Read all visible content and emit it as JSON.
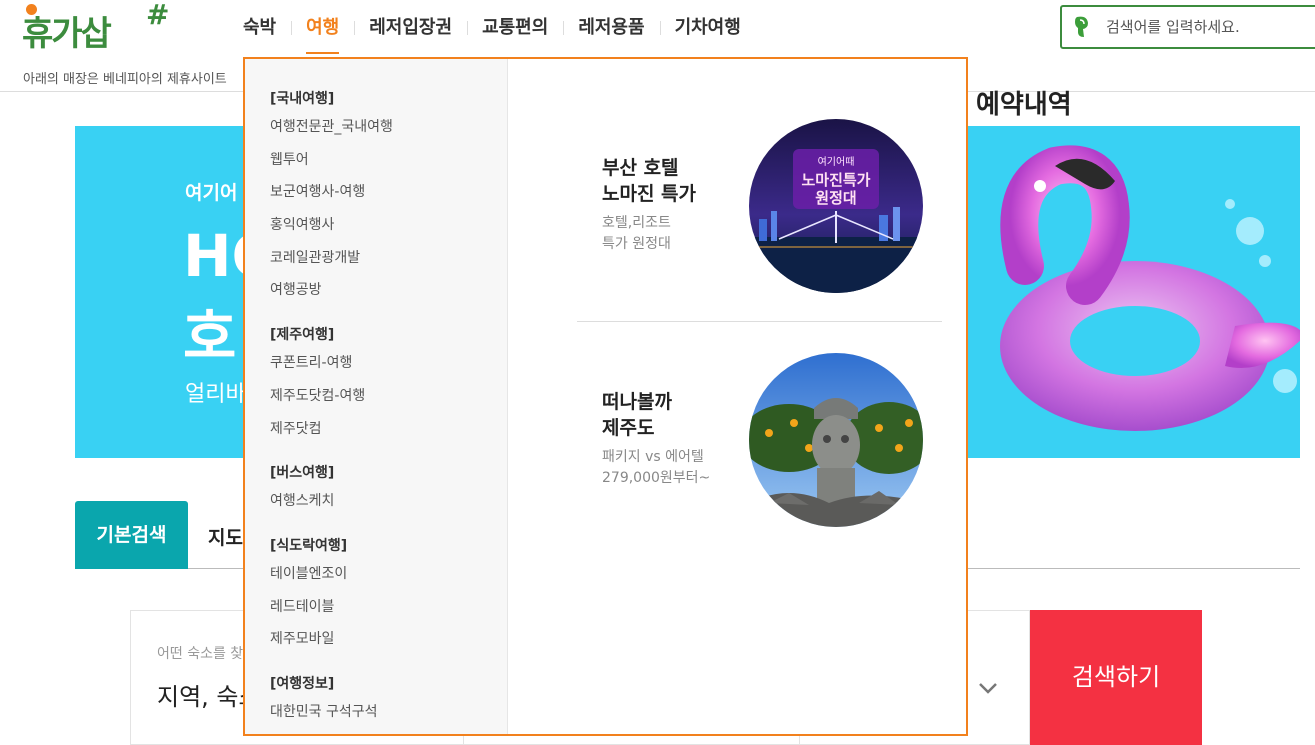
{
  "brand": {
    "logo_text": "휴가삽",
    "logo_hash": "#"
  },
  "nav": [
    {
      "label": "숙박",
      "active": false
    },
    {
      "label": "여행",
      "active": true
    },
    {
      "label": "레저입장권",
      "active": false
    },
    {
      "label": "교통편의",
      "active": false
    },
    {
      "label": "레저용품",
      "active": false
    },
    {
      "label": "기차여행",
      "active": false
    }
  ],
  "search": {
    "placeholder": "검색어를 입력하세요."
  },
  "notice": {
    "text": "아래의 매장은 베네피아의 제휴사이트"
  },
  "page": {
    "title_partial": "예약내역"
  },
  "banner": {
    "small_text": "여기어",
    "big_line1": "HO",
    "big_line2": "호",
    "sub_text": "얼리바"
  },
  "tabs": {
    "basic": "기본검색",
    "map": "지도"
  },
  "search_panel": {
    "label": "어떤 숙소를 찾",
    "value": "지역, 숙소",
    "button": "검색하기"
  },
  "dropdown": {
    "groups": [
      {
        "heading": "[국내여행]",
        "links": [
          "여행전문관_국내여행",
          "웹투어",
          "보군여행사-여행",
          "홍익여행사",
          "코레일관광개발",
          "여행공방"
        ]
      },
      {
        "heading": "[제주여행]",
        "links": [
          "쿠폰트리-여행",
          "제주도닷컴-여행",
          "제주닷컴"
        ]
      },
      {
        "heading": "[버스여행]",
        "links": [
          "여행스케치"
        ]
      },
      {
        "heading": "[식도락여행]",
        "links": [
          "테이블엔조이",
          "레드테이블",
          "제주모바일"
        ]
      },
      {
        "heading": "[여행정보]",
        "links": [
          "대한민국 구석구석"
        ]
      }
    ],
    "promos": [
      {
        "title_line1": "부산 호텔",
        "title_line2": "노마진 특가",
        "sub_line1": "호텔,리조트",
        "sub_line2": "특가 원정대",
        "img_badge": "여기어때",
        "img_line1": "노마진특가",
        "img_line2": "원정대"
      },
      {
        "title_line1": "떠나볼까",
        "title_line2": "제주도",
        "sub_line1": "패키지 vs 에어텔",
        "sub_line2": "279,000원부터~"
      }
    ]
  }
}
